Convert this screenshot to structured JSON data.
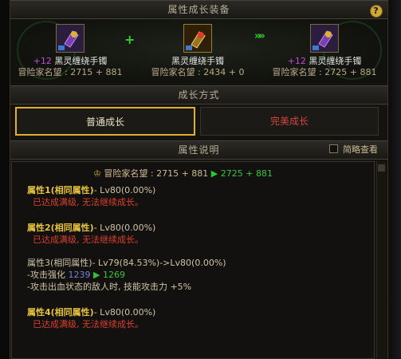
{
  "header": {
    "title": "属性成长装备",
    "help_label": "?"
  },
  "equip": {
    "left": {
      "plus": "+12",
      "name": "黑灵缠绕手镯",
      "fame": "冒险家名望 : 2715 + 881"
    },
    "middle": {
      "plus": "",
      "name": "黑灵缠绕手镯",
      "fame": "冒险家名望 : 2434 + 0"
    },
    "right": {
      "plus": "+12",
      "name": "黑灵缠绕手镯",
      "fame": "冒险家名望 : 2725 + 881"
    },
    "plus_symbol": "+",
    "arrows_symbol": "»»"
  },
  "growth": {
    "title": "成长方式",
    "normal_label": "普通成长",
    "perfect_label": "完美成长"
  },
  "desc": {
    "title": "属性说明",
    "toggle_label": "简略查看",
    "fame": {
      "label": "冒险家名望 : 2715 + 881",
      "to": "2725 + 881"
    },
    "attr1": {
      "title": "属性1(相同属性)",
      "lv": "- Lv80(0.00%)",
      "msg": "已达成满级, 无法继续成长。"
    },
    "attr2": {
      "title": "属性2(相同属性)",
      "lv": "- Lv80(0.00%)",
      "msg": "已达成满级, 无法继续成长。"
    },
    "attr3": {
      "title": "属性3(相同属性)- Lv79(84.53%)->Lv80(0.00%)",
      "line1_label": "-攻击强化",
      "line1_from": "1239",
      "line1_to": "1269",
      "line2": "-攻击出血状态的敌人时, 技能攻击力 +5%"
    },
    "attr4": {
      "title": "属性4(相同属性)",
      "lv": "- Lv80(0.00%)",
      "msg": "已达成满级, 无法继续成长。"
    }
  },
  "colors": {
    "accent_gold": "#e0b030",
    "green": "#3ec23e",
    "red": "#d8402f"
  }
}
